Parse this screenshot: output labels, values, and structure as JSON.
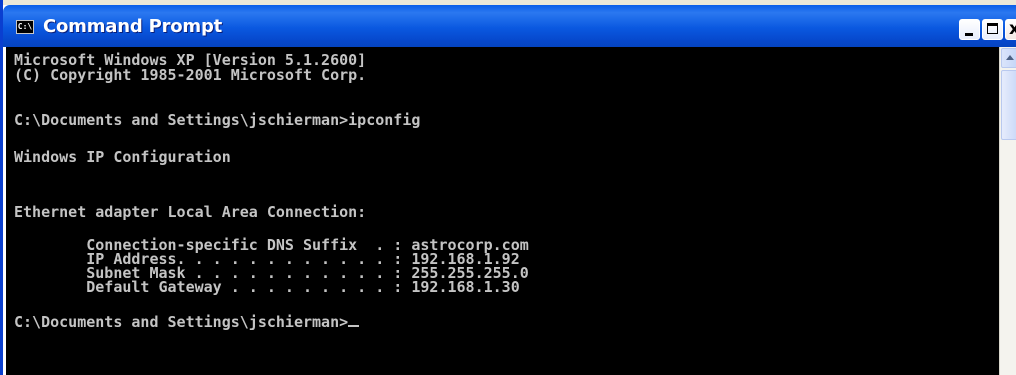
{
  "window": {
    "title": "Command Prompt",
    "icon": "console-icon",
    "icon_glyph": "C:\\",
    "controls": {
      "minimize": "minimize-icon",
      "maximize": "maximize-icon",
      "close": "close-icon",
      "close_glyph": "x"
    }
  },
  "console": {
    "lines": [
      "Microsoft Windows XP [Version 5.1.2600]",
      "(C) Copyright 1985-2001 Microsoft Corp.",
      "",
      "C:\\Documents and Settings\\jschierman>ipconfig",
      "",
      "Windows IP Configuration",
      "",
      "",
      "Ethernet adapter Local Area Connection:",
      "",
      "        Connection-specific DNS Suffix  . : astrocorp.com",
      "        IP Address. . . . . . . . . . . . : 192.168.1.92",
      "        Subnet Mask . . . . . . . . . . . : 255.255.255.0",
      "        Default Gateway . . . . . . . . . : 192.168.1.30",
      "",
      "C:\\Documents and Settings\\jschierman>"
    ],
    "colors": {
      "background": "#000000",
      "text": "#c4c4c4"
    }
  },
  "scrollbar": {
    "up_arrow": "arrow-up-icon"
  }
}
